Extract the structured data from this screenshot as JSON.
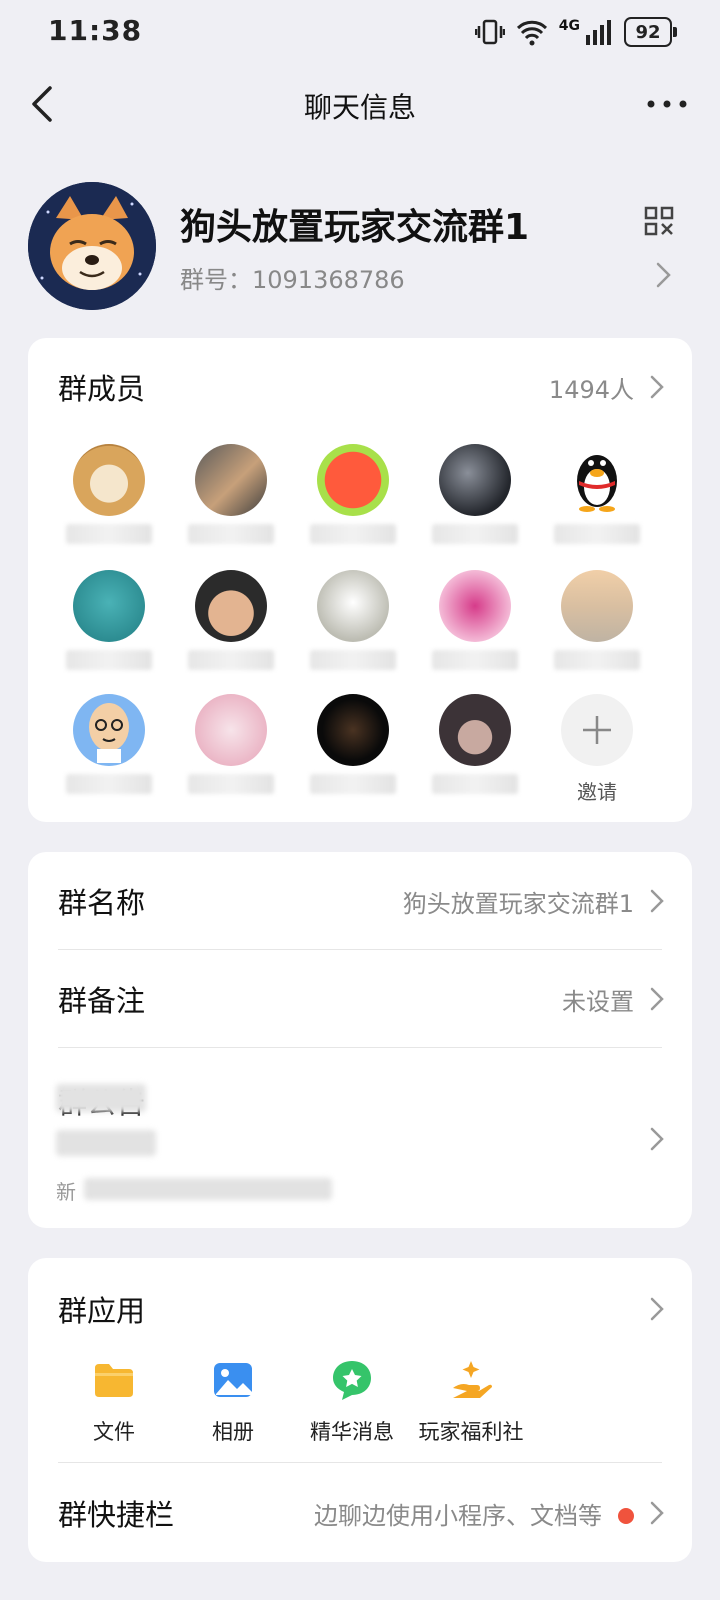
{
  "status_bar": {
    "time": "11:38",
    "battery": "92",
    "network": "4G"
  },
  "header": {
    "title": "聊天信息"
  },
  "group": {
    "name": "狗头放置玩家交流群1",
    "id_label": "群号：1091368786"
  },
  "members": {
    "label": "群成员",
    "count": "1494人",
    "invite_label": "邀请",
    "avatars": [
      "shiba-1",
      "shiba-2",
      "red-fox-cartoon",
      "dark-abstract",
      "qq-penguin",
      "blue-blob",
      "child-photo",
      "sun-glow",
      "pink-hearts",
      "toddler-beach",
      "bald-cartoon",
      "pink-blur",
      "black-blur",
      "dark-blur"
    ]
  },
  "settings": {
    "group_name_label": "群名称",
    "group_name_value": "狗头放置玩家交流群1",
    "group_remark_label": "群备注",
    "group_remark_value": "未设置",
    "announcement_label": "群公告",
    "announcement_prefix": "新"
  },
  "apps": {
    "label": "群应用",
    "items": [
      {
        "label": "文件",
        "icon": "folder-icon",
        "color": "#f7b731"
      },
      {
        "label": "相册",
        "icon": "photo-album-icon",
        "color": "#3a8ff0"
      },
      {
        "label": "精华消息",
        "icon": "star-message-icon",
        "color": "#35c46a"
      },
      {
        "label": "玩家福利社",
        "icon": "gift-hand-icon",
        "color": "#f5a623"
      }
    ],
    "shortcut_label": "群快捷栏",
    "shortcut_value": "边聊边使用小程序、文档等"
  },
  "colors": {
    "background": "#efeff4",
    "card": "#ffffff",
    "accent_red": "#f0533d"
  }
}
